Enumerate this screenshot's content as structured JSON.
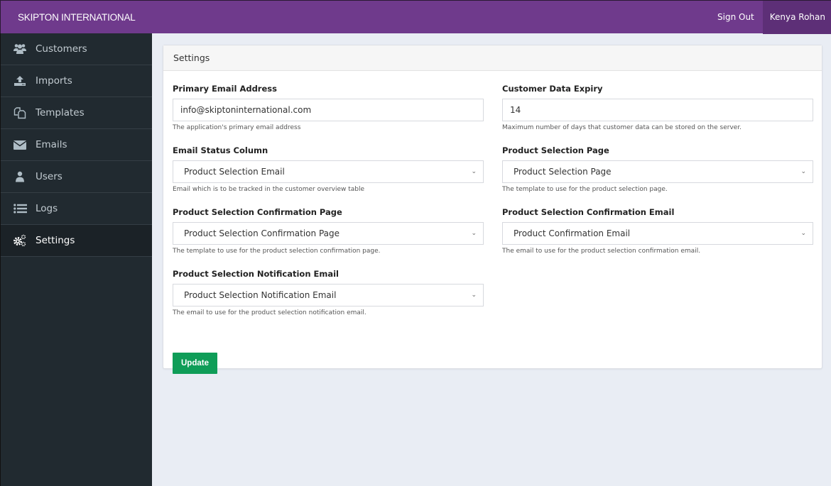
{
  "header": {
    "brand": "SKIPTON INTERNATIONAL",
    "sign_out": "Sign Out",
    "user_name": "Kenya Rohan",
    "colors": {
      "primary": "#6f3a8c",
      "user_bg": "#5d2f77"
    }
  },
  "sidebar": {
    "items": [
      {
        "label": "Customers",
        "icon": "users-icon",
        "active": false
      },
      {
        "label": "Imports",
        "icon": "upload-icon",
        "active": false
      },
      {
        "label": "Templates",
        "icon": "copy-icon",
        "active": false
      },
      {
        "label": "Emails",
        "icon": "envelope-icon",
        "active": false
      },
      {
        "label": "Users",
        "icon": "user-icon",
        "active": false
      },
      {
        "label": "Logs",
        "icon": "list-icon",
        "active": false
      },
      {
        "label": "Settings",
        "icon": "cogs-icon",
        "active": true
      }
    ]
  },
  "settings": {
    "title": "Settings",
    "fields": {
      "primary_email": {
        "label": "Primary Email Address",
        "value": "info@skiptoninternational.com",
        "help": "The application's primary email address"
      },
      "data_expiry": {
        "label": "Customer Data Expiry",
        "value": "14",
        "help": "Maximum number of days that customer data can be stored on the server."
      },
      "email_status_column": {
        "label": "Email Status Column",
        "selected": "Product Selection Email",
        "help": "Email which is to be tracked in the customer overview table"
      },
      "product_selection_page": {
        "label": "Product Selection Page",
        "selected": "Product Selection Page",
        "help": "The template to use for the product selection page."
      },
      "confirmation_page": {
        "label": "Product Selection Confirmation Page",
        "selected": "Product Selection Confirmation Page",
        "help": "The template to use for the product selection confirmation page."
      },
      "confirmation_email": {
        "label": "Product Selection Confirmation Email",
        "selected": "Product Confirmation Email",
        "help": "The email to use for the product selection confirmation email."
      },
      "notification_email": {
        "label": "Product Selection Notification Email",
        "selected": "Product Selection Notification Email",
        "help": "The email to use for the product selection notification email."
      }
    },
    "update_label": "Update",
    "update_color": "#0f9d58"
  }
}
